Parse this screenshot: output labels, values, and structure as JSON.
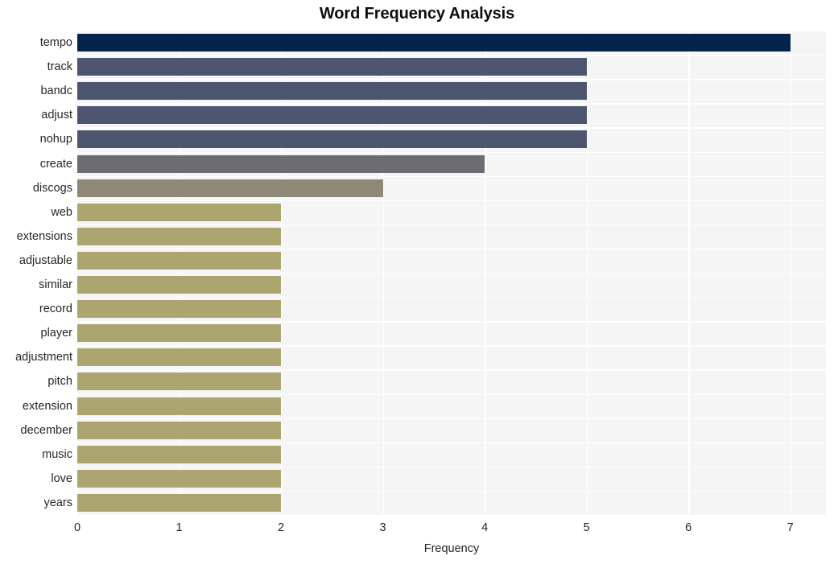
{
  "chart_data": {
    "type": "bar",
    "orientation": "horizontal",
    "title": "Word Frequency Analysis",
    "xlabel": "Frequency",
    "ylabel": "",
    "categories": [
      "tempo",
      "track",
      "bandc",
      "adjust",
      "nohup",
      "create",
      "discogs",
      "web",
      "extensions",
      "adjustable",
      "similar",
      "record",
      "player",
      "adjustment",
      "pitch",
      "extension",
      "december",
      "music",
      "love",
      "years"
    ],
    "values": [
      7,
      5,
      5,
      5,
      5,
      4,
      3,
      2,
      2,
      2,
      2,
      2,
      2,
      2,
      2,
      2,
      2,
      2,
      2,
      2
    ],
    "xlim": [
      0,
      7.35
    ],
    "xticks": [
      0,
      1,
      2,
      3,
      4,
      5,
      6,
      7
    ],
    "xtick_labels": [
      "0",
      "1",
      "2",
      "3",
      "4",
      "5",
      "6",
      "7"
    ],
    "grid": true,
    "grid_color": "#ffffff",
    "plot_background": "#f5f5f6",
    "legend": null,
    "bar_colors": [
      "#03244c",
      "#4d566e",
      "#4d566e",
      "#4d566e",
      "#4d566e",
      "#6b6d73",
      "#8e8878",
      "#ada570",
      "#ada570",
      "#ada570",
      "#ada570",
      "#ada570",
      "#ada570",
      "#ada570",
      "#ada570",
      "#ada570",
      "#ada570",
      "#ada570",
      "#ada570",
      "#ada570"
    ]
  },
  "colors": {
    "navy": "#03244c",
    "slate": "#4d566e",
    "gray": "#6b6d73",
    "warm_gray": "#8e8878",
    "khaki": "#ada570",
    "plot_bg": "#f5f5f6",
    "grid": "#ffffff",
    "text": "#262626",
    "title": "#0d0d0d"
  }
}
